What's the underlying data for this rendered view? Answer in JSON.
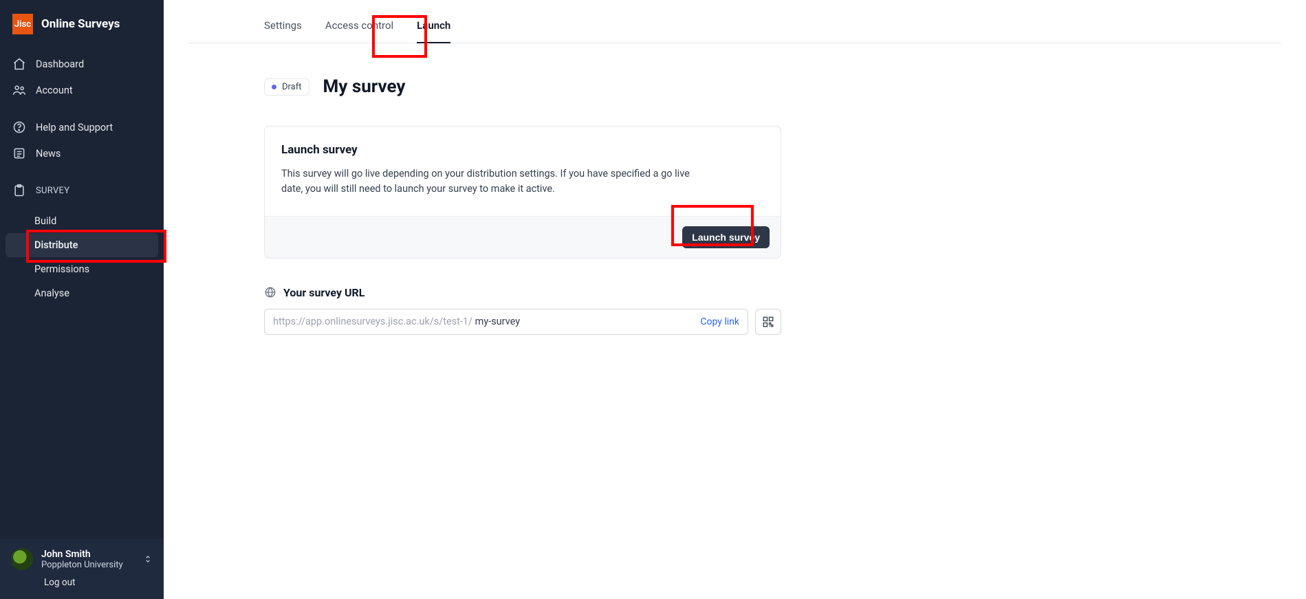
{
  "brand": {
    "badge": "Jisc",
    "title": "Online Surveys"
  },
  "nav": {
    "dashboard": "Dashboard",
    "account": "Account",
    "help": "Help and Support",
    "news": "News"
  },
  "survey_section": {
    "label": "SURVEY",
    "build": "Build",
    "distribute": "Distribute",
    "permissions": "Permissions",
    "analyse": "Analyse"
  },
  "user": {
    "name": "John Smith",
    "org": "Poppleton University",
    "logout": "Log out"
  },
  "tabs": {
    "settings": "Settings",
    "access_control": "Access control",
    "launch": "Launch"
  },
  "page": {
    "status": "Draft",
    "title": "My survey"
  },
  "launch_card": {
    "title": "Launch survey",
    "text": "This survey will go live depending on your distribution settings. If you have specified a go live date, you will still need to launch your survey to make it active.",
    "button": "Launch survey"
  },
  "url_section": {
    "heading": "Your survey URL",
    "base": "https://app.onlinesurveys.jisc.ac.uk/s/test-1/ ",
    "slug": "my-survey",
    "copy": "Copy link"
  }
}
